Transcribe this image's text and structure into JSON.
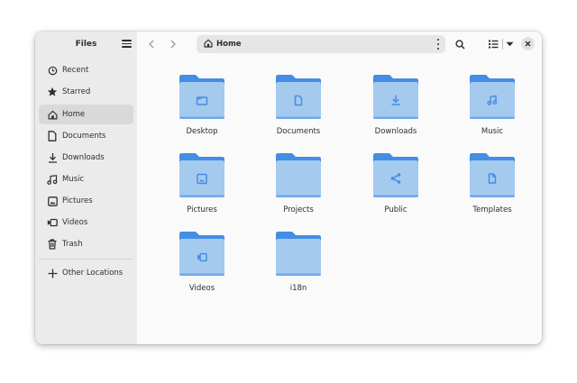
{
  "sidebar": {
    "title": "Files",
    "items": [
      {
        "label": "Recent",
        "icon": "clock-icon"
      },
      {
        "label": "Starred",
        "icon": "star-icon"
      },
      {
        "label": "Home",
        "icon": "home-icon",
        "active": true
      },
      {
        "label": "Documents",
        "icon": "document-icon"
      },
      {
        "label": "Downloads",
        "icon": "download-icon"
      },
      {
        "label": "Music",
        "icon": "music-icon"
      },
      {
        "label": "Pictures",
        "icon": "picture-icon"
      },
      {
        "label": "Videos",
        "icon": "video-icon"
      },
      {
        "label": "Trash",
        "icon": "trash-icon"
      }
    ],
    "other_locations": "Other Locations"
  },
  "toolbar": {
    "path": "Home"
  },
  "folders": [
    {
      "name": "Desktop",
      "emblem": "folder-emblem"
    },
    {
      "name": "Documents",
      "emblem": "document-emblem"
    },
    {
      "name": "Downloads",
      "emblem": "download-emblem"
    },
    {
      "name": "Music",
      "emblem": "music-emblem"
    },
    {
      "name": "Pictures",
      "emblem": "picture-emblem"
    },
    {
      "name": "Projects",
      "emblem": "none"
    },
    {
      "name": "Public",
      "emblem": "share-emblem"
    },
    {
      "name": "Templates",
      "emblem": "template-emblem"
    },
    {
      "name": "Videos",
      "emblem": "video-emblem"
    },
    {
      "name": "i18n",
      "emblem": "none"
    }
  ],
  "colors": {
    "folder_back": "#438de6",
    "folder_front": "#a4caee",
    "emblem": "#438de6"
  }
}
